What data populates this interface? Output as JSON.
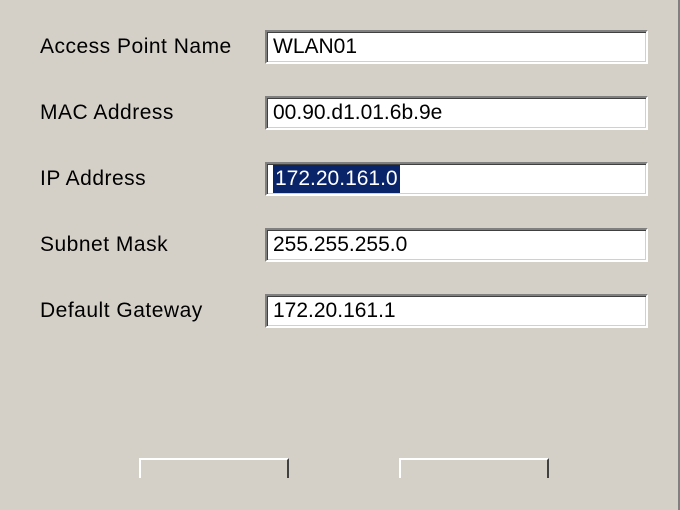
{
  "labels": {
    "access_point_name": "Access Point Name",
    "mac_address": "MAC Address",
    "ip_address": "IP Address",
    "subnet_mask": "Subnet Mask",
    "default_gateway": "Default Gateway"
  },
  "values": {
    "access_point_name": "WLAN01",
    "mac_address": "00.90.d1.01.6b.9e",
    "ip_address": "172.20.161.0",
    "subnet_mask": "255.255.255.0",
    "default_gateway": "172.20.161.1"
  },
  "buttons": {
    "ok": "",
    "cancel": ""
  }
}
